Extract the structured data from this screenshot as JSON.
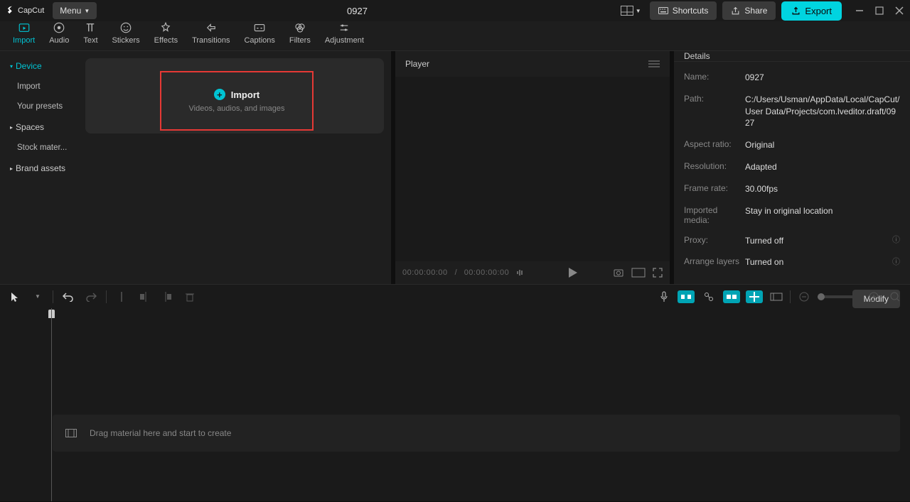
{
  "app": {
    "name": "CapCut",
    "menu": "Menu"
  },
  "title": "0927",
  "toolbar": {
    "shortcuts": "Shortcuts",
    "share": "Share",
    "export": "Export"
  },
  "tabs": [
    {
      "label": "Import",
      "active": true
    },
    {
      "label": "Audio"
    },
    {
      "label": "Text"
    },
    {
      "label": "Stickers"
    },
    {
      "label": "Effects"
    },
    {
      "label": "Transitions"
    },
    {
      "label": "Captions"
    },
    {
      "label": "Filters"
    },
    {
      "label": "Adjustment"
    }
  ],
  "sidebar": {
    "items": [
      {
        "label": "Device",
        "type": "expand",
        "active": true
      },
      {
        "label": "Import",
        "type": "sub"
      },
      {
        "label": "Your presets",
        "type": "sub"
      },
      {
        "label": "Spaces",
        "type": "expand"
      },
      {
        "label": "Stock mater...",
        "type": "sub"
      },
      {
        "label": "Brand assets",
        "type": "expand"
      }
    ]
  },
  "import_box": {
    "label": "Import",
    "sub": "Videos, audios, and images"
  },
  "player": {
    "title": "Player",
    "time_current": "00:00:00:00",
    "time_total": "00:00:00:00"
  },
  "details": {
    "title": "Details",
    "rows": {
      "name_lbl": "Name:",
      "name_val": "0927",
      "path_lbl": "Path:",
      "path_val": "C:/Users/Usman/AppData/Local/CapCut/User Data/Projects/com.lveditor.draft/0927",
      "aspect_lbl": "Aspect ratio:",
      "aspect_val": "Original",
      "res_lbl": "Resolution:",
      "res_val": "Adapted",
      "fps_lbl": "Frame rate:",
      "fps_val": "30.00fps",
      "media_lbl": "Imported media:",
      "media_val": "Stay in original location",
      "proxy_lbl": "Proxy:",
      "proxy_val": "Turned off",
      "layers_lbl": "Arrange layers",
      "layers_val": "Turned on"
    },
    "modify": "Modify"
  },
  "timeline": {
    "drop_hint": "Drag material here and start to create"
  }
}
